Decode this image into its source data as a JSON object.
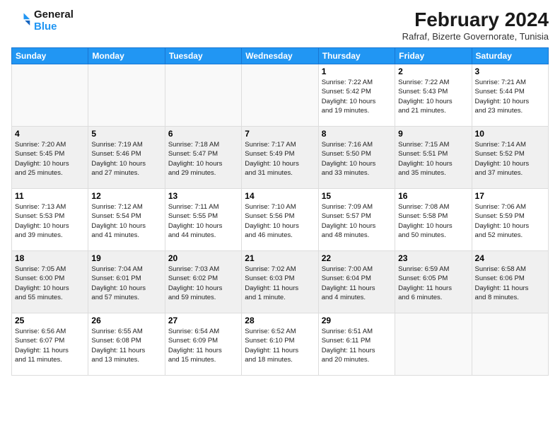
{
  "logo": {
    "line1": "General",
    "line2": "Blue"
  },
  "title": "February 2024",
  "subtitle": "Rafraf, Bizerte Governorate, Tunisia",
  "weekdays": [
    "Sunday",
    "Monday",
    "Tuesday",
    "Wednesday",
    "Thursday",
    "Friday",
    "Saturday"
  ],
  "weeks": [
    [
      {
        "day": "",
        "info": ""
      },
      {
        "day": "",
        "info": ""
      },
      {
        "day": "",
        "info": ""
      },
      {
        "day": "",
        "info": ""
      },
      {
        "day": "1",
        "info": "Sunrise: 7:22 AM\nSunset: 5:42 PM\nDaylight: 10 hours\nand 19 minutes."
      },
      {
        "day": "2",
        "info": "Sunrise: 7:22 AM\nSunset: 5:43 PM\nDaylight: 10 hours\nand 21 minutes."
      },
      {
        "day": "3",
        "info": "Sunrise: 7:21 AM\nSunset: 5:44 PM\nDaylight: 10 hours\nand 23 minutes."
      }
    ],
    [
      {
        "day": "4",
        "info": "Sunrise: 7:20 AM\nSunset: 5:45 PM\nDaylight: 10 hours\nand 25 minutes."
      },
      {
        "day": "5",
        "info": "Sunrise: 7:19 AM\nSunset: 5:46 PM\nDaylight: 10 hours\nand 27 minutes."
      },
      {
        "day": "6",
        "info": "Sunrise: 7:18 AM\nSunset: 5:47 PM\nDaylight: 10 hours\nand 29 minutes."
      },
      {
        "day": "7",
        "info": "Sunrise: 7:17 AM\nSunset: 5:49 PM\nDaylight: 10 hours\nand 31 minutes."
      },
      {
        "day": "8",
        "info": "Sunrise: 7:16 AM\nSunset: 5:50 PM\nDaylight: 10 hours\nand 33 minutes."
      },
      {
        "day": "9",
        "info": "Sunrise: 7:15 AM\nSunset: 5:51 PM\nDaylight: 10 hours\nand 35 minutes."
      },
      {
        "day": "10",
        "info": "Sunrise: 7:14 AM\nSunset: 5:52 PM\nDaylight: 10 hours\nand 37 minutes."
      }
    ],
    [
      {
        "day": "11",
        "info": "Sunrise: 7:13 AM\nSunset: 5:53 PM\nDaylight: 10 hours\nand 39 minutes."
      },
      {
        "day": "12",
        "info": "Sunrise: 7:12 AM\nSunset: 5:54 PM\nDaylight: 10 hours\nand 41 minutes."
      },
      {
        "day": "13",
        "info": "Sunrise: 7:11 AM\nSunset: 5:55 PM\nDaylight: 10 hours\nand 44 minutes."
      },
      {
        "day": "14",
        "info": "Sunrise: 7:10 AM\nSunset: 5:56 PM\nDaylight: 10 hours\nand 46 minutes."
      },
      {
        "day": "15",
        "info": "Sunrise: 7:09 AM\nSunset: 5:57 PM\nDaylight: 10 hours\nand 48 minutes."
      },
      {
        "day": "16",
        "info": "Sunrise: 7:08 AM\nSunset: 5:58 PM\nDaylight: 10 hours\nand 50 minutes."
      },
      {
        "day": "17",
        "info": "Sunrise: 7:06 AM\nSunset: 5:59 PM\nDaylight: 10 hours\nand 52 minutes."
      }
    ],
    [
      {
        "day": "18",
        "info": "Sunrise: 7:05 AM\nSunset: 6:00 PM\nDaylight: 10 hours\nand 55 minutes."
      },
      {
        "day": "19",
        "info": "Sunrise: 7:04 AM\nSunset: 6:01 PM\nDaylight: 10 hours\nand 57 minutes."
      },
      {
        "day": "20",
        "info": "Sunrise: 7:03 AM\nSunset: 6:02 PM\nDaylight: 10 hours\nand 59 minutes."
      },
      {
        "day": "21",
        "info": "Sunrise: 7:02 AM\nSunset: 6:03 PM\nDaylight: 11 hours\nand 1 minute."
      },
      {
        "day": "22",
        "info": "Sunrise: 7:00 AM\nSunset: 6:04 PM\nDaylight: 11 hours\nand 4 minutes."
      },
      {
        "day": "23",
        "info": "Sunrise: 6:59 AM\nSunset: 6:05 PM\nDaylight: 11 hours\nand 6 minutes."
      },
      {
        "day": "24",
        "info": "Sunrise: 6:58 AM\nSunset: 6:06 PM\nDaylight: 11 hours\nand 8 minutes."
      }
    ],
    [
      {
        "day": "25",
        "info": "Sunrise: 6:56 AM\nSunset: 6:07 PM\nDaylight: 11 hours\nand 11 minutes."
      },
      {
        "day": "26",
        "info": "Sunrise: 6:55 AM\nSunset: 6:08 PM\nDaylight: 11 hours\nand 13 minutes."
      },
      {
        "day": "27",
        "info": "Sunrise: 6:54 AM\nSunset: 6:09 PM\nDaylight: 11 hours\nand 15 minutes."
      },
      {
        "day": "28",
        "info": "Sunrise: 6:52 AM\nSunset: 6:10 PM\nDaylight: 11 hours\nand 18 minutes."
      },
      {
        "day": "29",
        "info": "Sunrise: 6:51 AM\nSunset: 6:11 PM\nDaylight: 11 hours\nand 20 minutes."
      },
      {
        "day": "",
        "info": ""
      },
      {
        "day": "",
        "info": ""
      }
    ]
  ]
}
